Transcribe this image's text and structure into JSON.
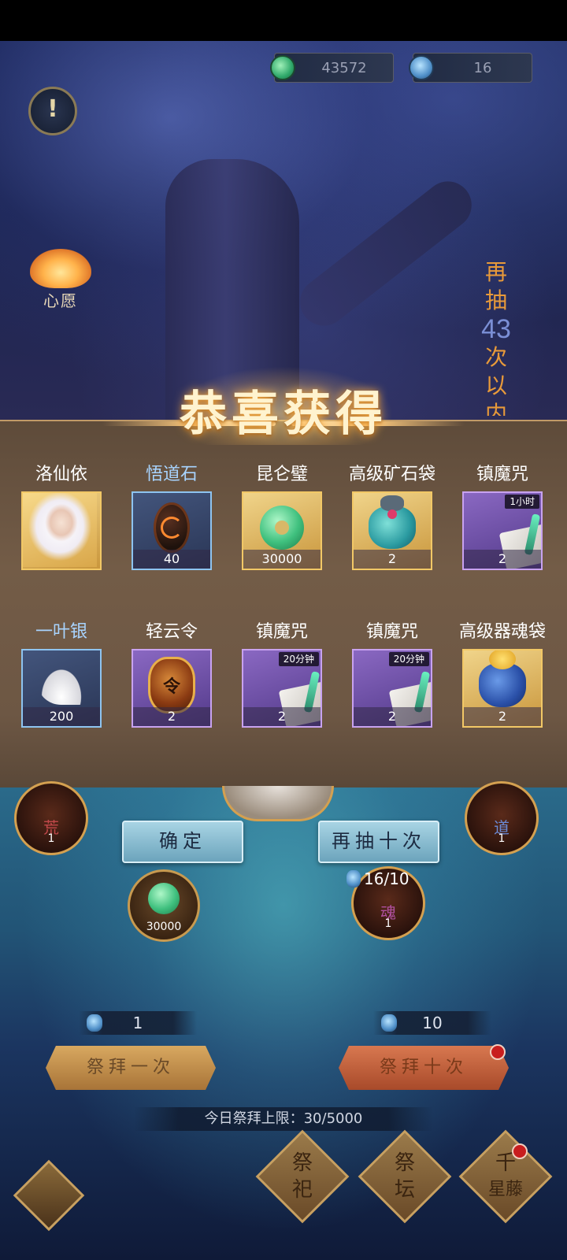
{
  "top": {
    "currencies": [
      {
        "icon": "jade-coin-icon",
        "value": "43572"
      },
      {
        "icon": "spirit-bottle-icon",
        "value": "16"
      }
    ],
    "info_icon": "!",
    "wish_label": "心愿",
    "pity": {
      "prefix": [
        "再",
        "抽"
      ],
      "count": "43",
      "suffix": [
        "次",
        "以",
        "内"
      ]
    }
  },
  "reward_banner": {
    "title": "恭喜获得"
  },
  "rewards": [
    {
      "name": "洛仙依",
      "rarity": "gold",
      "quantity": "",
      "tag": "",
      "icon": "character-portrait"
    },
    {
      "name": "悟道石",
      "rarity": "blue",
      "quantity": "40",
      "tag": "",
      "icon": "dao-stone-icon"
    },
    {
      "name": "昆仑璧",
      "rarity": "gold",
      "quantity": "30000",
      "tag": "",
      "icon": "jade-disc-icon"
    },
    {
      "name": "高级矿石袋",
      "rarity": "gold",
      "quantity": "2",
      "tag": "",
      "icon": "ore-bag-icon"
    },
    {
      "name": "镇魔咒",
      "rarity": "purple",
      "quantity": "2",
      "tag": "1小时",
      "icon": "talisman-scroll-icon"
    },
    {
      "name": "一叶银",
      "rarity": "blue",
      "quantity": "200",
      "tag": "",
      "icon": "ginkgo-leaf-icon"
    },
    {
      "name": "轻云令",
      "rarity": "purple",
      "quantity": "2",
      "tag": "",
      "icon": "cloud-token-icon"
    },
    {
      "name": "镇魔咒",
      "rarity": "purple",
      "quantity": "2",
      "tag": "20分钟",
      "icon": "talisman-scroll-icon"
    },
    {
      "name": "镇魔咒",
      "rarity": "purple",
      "quantity": "2",
      "tag": "20分钟",
      "icon": "talisman-scroll-icon"
    },
    {
      "name": "高级器魂袋",
      "rarity": "gold",
      "quantity": "2",
      "tag": "",
      "icon": "soul-bag-icon"
    }
  ],
  "token_mark": "令",
  "altar": {
    "left_orb": {
      "glyph": "荒",
      "count": "1"
    },
    "right_orb": {
      "glyph": "道",
      "count": "1"
    },
    "soul_orb": {
      "glyph": "魂",
      "count": "1"
    },
    "jade_coin": {
      "count": "30000"
    },
    "pity_progress": "16/10"
  },
  "buttons": {
    "confirm": "确定",
    "draw_ten_again": "再抽十次",
    "pray_once": "祭拜一次",
    "pray_ten": "祭拜十次"
  },
  "costs": {
    "once": "1",
    "ten": "10"
  },
  "daily_limit": "今日祭拜上限：30/5000",
  "nav": [
    {
      "line1": "祭",
      "line2": "祀"
    },
    {
      "line1": "祭",
      "line2": "坛"
    },
    {
      "line1": "千",
      "line2": "星藤"
    }
  ],
  "colors": {
    "gold_frame": "#f2c866",
    "blue_frame": "#8ec4f0",
    "purple_frame": "#c8a2f0",
    "banner_text": "#fff3cf"
  }
}
